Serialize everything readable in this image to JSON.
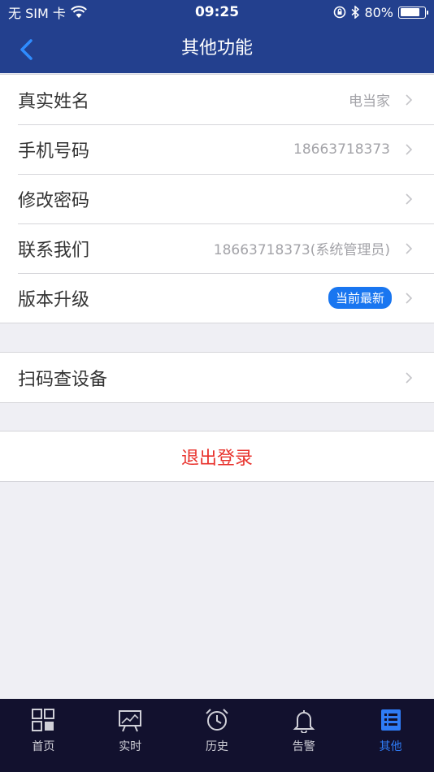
{
  "status_bar": {
    "carrier": "无 SIM 卡",
    "time": "09:25",
    "battery": "80%",
    "battery_level": 0.8
  },
  "navbar": {
    "title": "其他功能"
  },
  "settings": {
    "real_name": {
      "label": "真实姓名",
      "value": "电当家"
    },
    "phone": {
      "label": "手机号码",
      "value": "18663718373"
    },
    "change_password": {
      "label": "修改密码"
    },
    "contact": {
      "label": "联系我们",
      "value": "18663718373(系统管理员)"
    },
    "version": {
      "label": "版本升级",
      "badge": "当前最新"
    },
    "scan": {
      "label": "扫码查设备"
    },
    "logout": {
      "label": "退出登录"
    }
  },
  "colors": {
    "primary": "#23408e",
    "accent": "#2f7cf6",
    "danger": "#e8322c",
    "tabbar": "#12112e"
  },
  "tabs": [
    {
      "label": "首页",
      "icon": "grid-icon"
    },
    {
      "label": "实时",
      "icon": "monitor-icon"
    },
    {
      "label": "历史",
      "icon": "alarm-clock-icon"
    },
    {
      "label": "告警",
      "icon": "bell-icon"
    },
    {
      "label": "其他",
      "icon": "list-icon",
      "active": true
    }
  ]
}
